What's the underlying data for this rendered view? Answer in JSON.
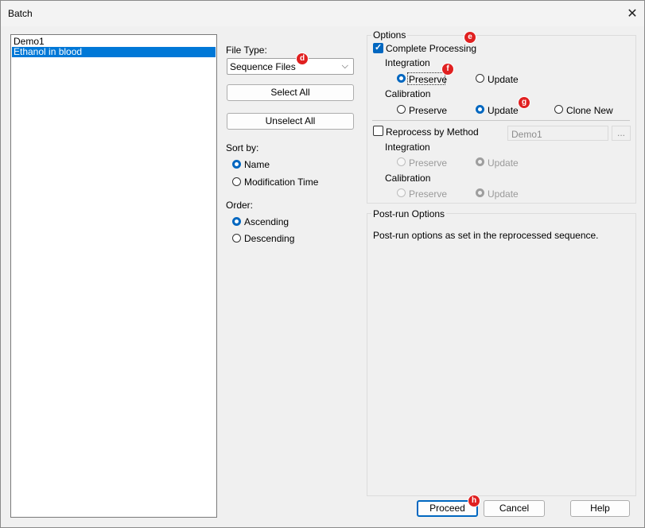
{
  "window": {
    "title": "Batch",
    "close_glyph": "✕"
  },
  "sequence_list": {
    "items": [
      "Demo1",
      "Ethanol in blood"
    ],
    "selected_index": 1
  },
  "file_type": {
    "label": "File Type:",
    "value": "Sequence Files",
    "arrow": "⌵"
  },
  "buttons": {
    "select_all": "Select All",
    "unselect_all": "Unselect All",
    "proceed": "Proceed",
    "cancel": "Cancel",
    "help": "Help"
  },
  "sort_by": {
    "label": "Sort by:",
    "options": [
      "Name",
      "Modification Time"
    ],
    "selected": "Name"
  },
  "order": {
    "label": "Order:",
    "options": [
      "Ascending",
      "Descending"
    ],
    "selected": "Ascending"
  },
  "options_group": {
    "title": "Options",
    "complete_processing": {
      "label": "Complete Processing",
      "checked": true
    },
    "integration": {
      "label": "Integration",
      "options": [
        "Preserve",
        "Update"
      ],
      "selected": "Preserve"
    },
    "calibration": {
      "label": "Calibration",
      "options": [
        "Preserve",
        "Update",
        "Clone New"
      ],
      "selected": "Update"
    },
    "reprocess_by_method": {
      "label": "Reprocess by Method",
      "checked": false,
      "method": "Demo1",
      "browse": "..."
    },
    "reprocess_integration": {
      "label": "Integration",
      "options": [
        "Preserve",
        "Update"
      ],
      "selected": "Update"
    },
    "reprocess_calibration": {
      "label": "Calibration",
      "options": [
        "Preserve",
        "Update"
      ],
      "selected": "Update"
    }
  },
  "post_run": {
    "title": "Post-run Options",
    "text": "Post-run options as set in the reprocessed sequence."
  },
  "markers": {
    "d": "d",
    "e": "e",
    "f": "f",
    "g": "g",
    "h": "h"
  },
  "colors": {
    "accent": "#0067c0",
    "selection": "#0078d7",
    "marker": "#e02020"
  }
}
